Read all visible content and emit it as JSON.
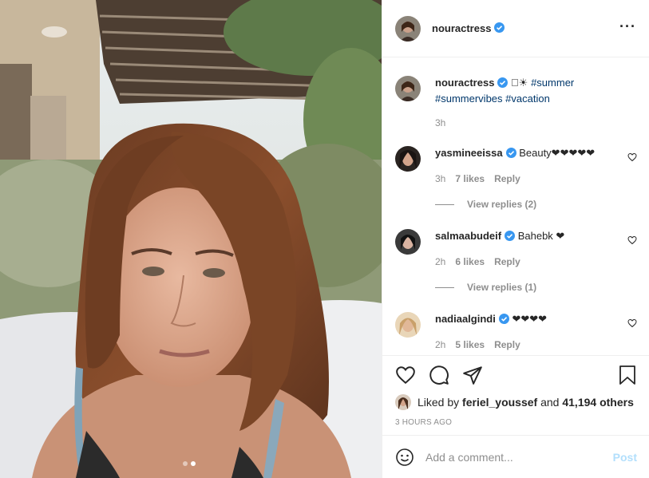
{
  "post": {
    "author": "nouractress",
    "caption_prefix": "􏿽☀",
    "caption_tags": [
      "#summer",
      "#summervibes",
      "#vacation"
    ],
    "caption_time": "3h",
    "carousel_dots": 2,
    "carousel_active": 2
  },
  "comments": [
    {
      "username": "yasmineeissa",
      "text": "Beauty❤❤❤❤❤",
      "time": "3h",
      "likes": "7 likes",
      "reply": "Reply",
      "view_replies": "View replies (2)"
    },
    {
      "username": "salmaabudeif",
      "text": "Bahebk ❤",
      "time": "2h",
      "likes": "6 likes",
      "reply": "Reply",
      "view_replies": "View replies (1)"
    },
    {
      "username": "nadiaalgindi",
      "text": "❤❤❤❤",
      "time": "2h",
      "likes": "5 likes",
      "reply": "Reply"
    }
  ],
  "likes": {
    "prefix": "Liked by",
    "user": "feriel_youssef",
    "middle": "and",
    "others": "41,194 others"
  },
  "timestamp": "3 HOURS AGO",
  "add_comment": {
    "placeholder": "Add a comment...",
    "post_label": "Post"
  },
  "icons": {
    "more": "more-options-icon",
    "like": "heart-icon",
    "comment": "comment-icon",
    "share": "paper-plane-icon",
    "save": "bookmark-icon",
    "emoji": "emoji-icon",
    "verified": "verified-badge-icon"
  },
  "colors": {
    "verified": "#3897f0",
    "link": "#00376b",
    "muted": "#8e8e8e",
    "post_disabled": "#b2dffc"
  }
}
